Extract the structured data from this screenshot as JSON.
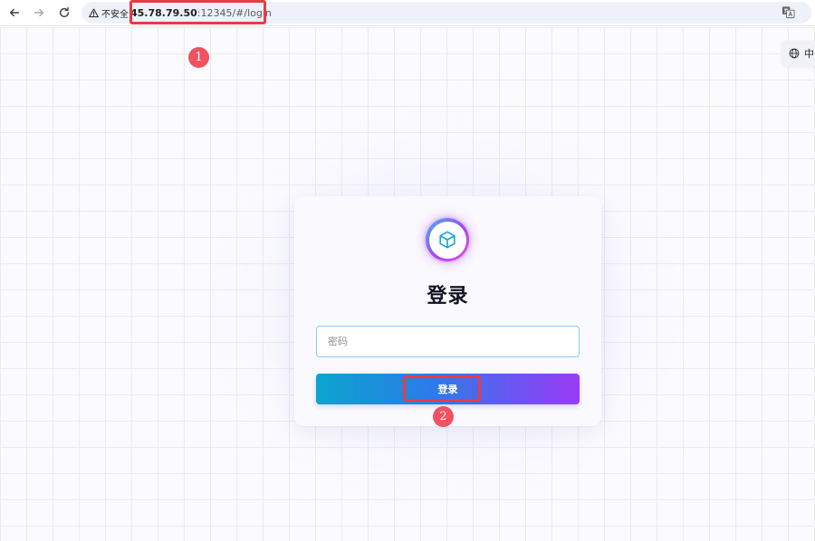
{
  "browser": {
    "security_label": "不安全",
    "url_host": "45.78.79.50",
    "url_path": ":12345/#/login"
  },
  "page": {
    "language_label": "中"
  },
  "login": {
    "title": "登录",
    "password_placeholder": "密码",
    "submit_label": "登录"
  },
  "annotations": {
    "badge_1": "1",
    "badge_2": "2"
  },
  "colors": {
    "annotation_red": "#ea3a44",
    "button_gradient": [
      "#0aa5cf",
      "#2d7ae8",
      "#6b55f2",
      "#9a3bf5"
    ],
    "logo_icon": "#1aa6c9"
  },
  "icons": {
    "back": "arrow-left-icon",
    "forward": "arrow-right-icon",
    "reload": "reload-icon",
    "security": "warning-triangle-icon",
    "translate": "translate-icon",
    "language": "globe-icon",
    "logo": "cube-icon"
  }
}
